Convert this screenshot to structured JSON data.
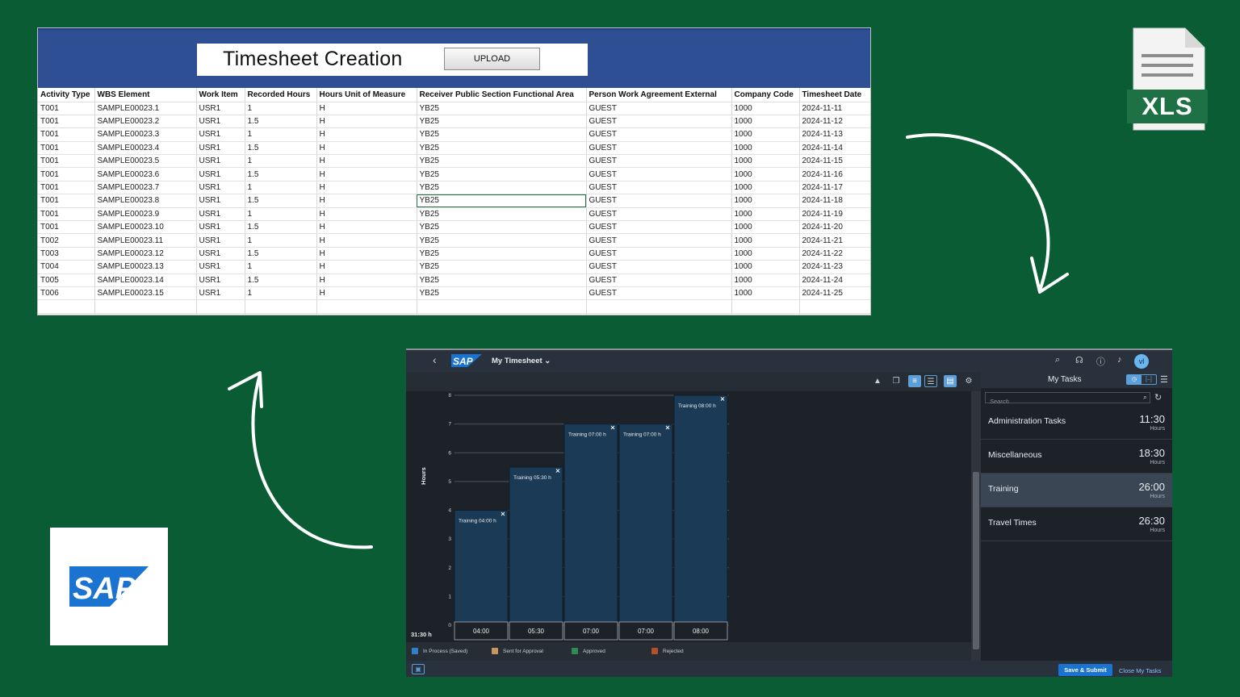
{
  "excel": {
    "title": "Timesheet Creation",
    "upload_label": "UPLOAD",
    "columns": [
      "Activity Type",
      "WBS Element",
      "Work Item",
      "Recorded Hours",
      "Hours Unit of Measure",
      "Receiver Public Section Functional Area",
      "Person Work Agreement External",
      "Company Code",
      "Timesheet Date"
    ],
    "rows": [
      [
        "T001",
        "SAMPLE00023.1",
        "USR1",
        "1",
        "H",
        "YB25",
        "GUEST",
        "1000",
        "2024-11-11"
      ],
      [
        "T001",
        "SAMPLE00023.2",
        "USR1",
        "1.5",
        "H",
        "YB25",
        "GUEST",
        "1000",
        "2024-11-12"
      ],
      [
        "T001",
        "SAMPLE00023.3",
        "USR1",
        "1",
        "H",
        "YB25",
        "GUEST",
        "1000",
        "2024-11-13"
      ],
      [
        "T001",
        "SAMPLE00023.4",
        "USR1",
        "1.5",
        "H",
        "YB25",
        "GUEST",
        "1000",
        "2024-11-14"
      ],
      [
        "T001",
        "SAMPLE00023.5",
        "USR1",
        "1",
        "H",
        "YB25",
        "GUEST",
        "1000",
        "2024-11-15"
      ],
      [
        "T001",
        "SAMPLE00023.6",
        "USR1",
        "1.5",
        "H",
        "YB25",
        "GUEST",
        "1000",
        "2024-11-16"
      ],
      [
        "T001",
        "SAMPLE00023.7",
        "USR1",
        "1",
        "H",
        "YB25",
        "GUEST",
        "1000",
        "2024-11-17"
      ],
      [
        "T001",
        "SAMPLE00023.8",
        "USR1",
        "1.5",
        "H",
        "YB25",
        "GUEST",
        "1000",
        "2024-11-18"
      ],
      [
        "T001",
        "SAMPLE00023.9",
        "USR1",
        "1",
        "H",
        "YB25",
        "GUEST",
        "1000",
        "2024-11-19"
      ],
      [
        "T001",
        "SAMPLE00023.10",
        "USR1",
        "1.5",
        "H",
        "YB25",
        "GUEST",
        "1000",
        "2024-11-20"
      ],
      [
        "T002",
        "SAMPLE00023.11",
        "USR1",
        "1",
        "H",
        "YB25",
        "GUEST",
        "1000",
        "2024-11-21"
      ],
      [
        "T003",
        "SAMPLE00023.12",
        "USR1",
        "1.5",
        "H",
        "YB25",
        "GUEST",
        "1000",
        "2024-11-22"
      ],
      [
        "T004",
        "SAMPLE00023.13",
        "USR1",
        "1",
        "H",
        "YB25",
        "GUEST",
        "1000",
        "2024-11-23"
      ],
      [
        "T005",
        "SAMPLE00023.14",
        "USR1",
        "1.5",
        "H",
        "YB25",
        "GUEST",
        "1000",
        "2024-11-24"
      ],
      [
        "T006",
        "SAMPLE00023.15",
        "USR1",
        "1",
        "H",
        "YB25",
        "GUEST",
        "1000",
        "2024-11-25"
      ]
    ],
    "selected_cell": {
      "row": 7,
      "col": 5
    }
  },
  "xls_icon": {
    "label": "XLS",
    "color": "#1e7145"
  },
  "sap_logo": {
    "text": "SAP",
    "color": "#1a73d1"
  },
  "sap": {
    "back_icon": "chevron-left-icon",
    "app_title": "My Timesheet",
    "shell_icons": [
      "search-icon",
      "headset-icon",
      "help-icon",
      "bell-icon"
    ],
    "avatar_initials": "vl",
    "total": "31:30 h",
    "chart_data": {
      "type": "bar",
      "ylabel": "Hours",
      "ylim": [
        0,
        8
      ],
      "yticks": [
        "0",
        "1",
        "2",
        "3",
        "4",
        "5",
        "6",
        "7",
        "8"
      ],
      "categories": [
        "04:00",
        "05:30",
        "07:00",
        "07:00",
        "08:00"
      ],
      "values": [
        4,
        5.5,
        7,
        7,
        8
      ],
      "bar_labels": [
        "Training 04:00 h",
        "Training 05:30 h",
        "Training 07:00 h",
        "Training 07:00 h",
        "Training 08:00 h"
      ],
      "bar_color": "#1b3a55"
    },
    "legend": [
      {
        "label": "In Process (Saved)",
        "color": "#2f7fc9"
      },
      {
        "label": "Sent for Approval",
        "color": "#c9955a"
      },
      {
        "label": "Approved",
        "color": "#2e8b57"
      },
      {
        "label": "Rejected",
        "color": "#b5502a"
      }
    ],
    "tasks": {
      "title": "My Tasks",
      "search_placeholder": "Search",
      "items": [
        {
          "name": "Administration Tasks",
          "hours": "11:30",
          "unit": "Hours"
        },
        {
          "name": "Miscellaneous",
          "hours": "18:30",
          "unit": "Hours"
        },
        {
          "name": "Training",
          "hours": "26:00",
          "unit": "Hours"
        },
        {
          "name": "Travel Times",
          "hours": "26:30",
          "unit": "Hours"
        }
      ],
      "selected_index": 2
    },
    "save_label": "Save & Submit",
    "close_label": "Close My Tasks"
  }
}
